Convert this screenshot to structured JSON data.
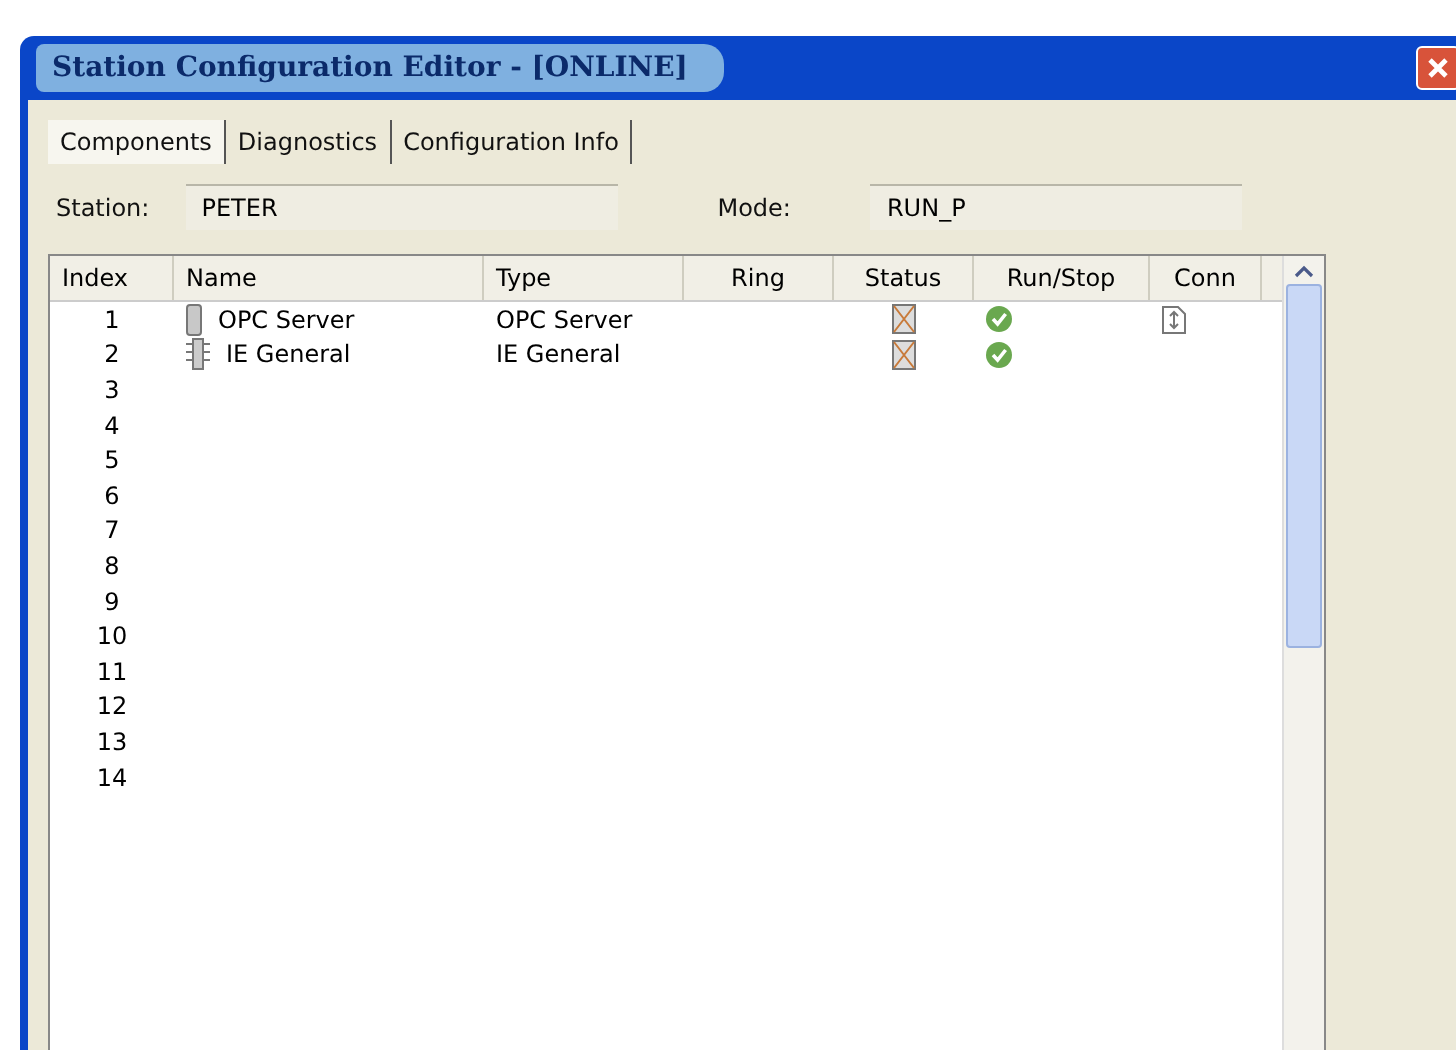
{
  "window": {
    "title": "Station Configuration Editor - [ONLINE]"
  },
  "tabs": [
    {
      "label": "Components",
      "selected": true
    },
    {
      "label": "Diagnostics",
      "selected": false
    },
    {
      "label": "Configuration Info",
      "selected": false
    }
  ],
  "station": {
    "label": "Station:",
    "value": "PETER"
  },
  "mode": {
    "label": "Mode:",
    "value": "RUN_P"
  },
  "table": {
    "columns": [
      "Index",
      "Name",
      "Type",
      "Ring",
      "Status",
      "Run/Stop",
      "Conn"
    ],
    "rows": [
      {
        "index": "1",
        "name": "OPC Server",
        "type": "OPC Server",
        "kind": "server",
        "status_icon": true,
        "running": true,
        "conn": true
      },
      {
        "index": "2",
        "name": "IE General",
        "type": "IE General",
        "kind": "module",
        "status_icon": true,
        "running": true,
        "conn": false
      },
      {
        "index": "3"
      },
      {
        "index": "4"
      },
      {
        "index": "5"
      },
      {
        "index": "6"
      },
      {
        "index": "7"
      },
      {
        "index": "8"
      },
      {
        "index": "9"
      },
      {
        "index": "10"
      },
      {
        "index": "11"
      },
      {
        "index": "12"
      },
      {
        "index": "13"
      },
      {
        "index": "14"
      }
    ]
  }
}
